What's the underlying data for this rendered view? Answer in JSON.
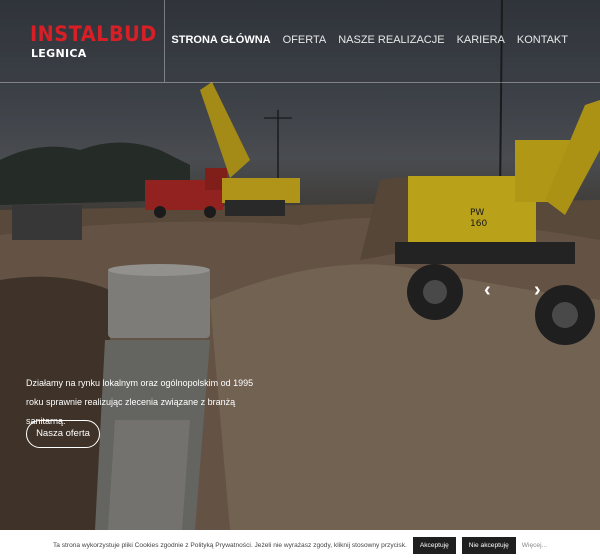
{
  "brand": {
    "name": "INSTALBUD",
    "city": "LEGNICA"
  },
  "nav": {
    "items": [
      {
        "label": "STRONA GŁÓWNA",
        "active": true
      },
      {
        "label": "OFERTA",
        "active": false
      },
      {
        "label": "NASZE REALIZACJE",
        "active": false
      },
      {
        "label": "KARIERA",
        "active": false
      },
      {
        "label": "KONTAKT",
        "active": false
      }
    ]
  },
  "hero": {
    "tagline": "Działamy na rynku lokalnym oraz ogólnopolskim od 1995 roku sprawnie realizując zlecenia związane z branżą sanitarną.",
    "cta_label": "Nasza oferta",
    "prev_arrow": "‹",
    "next_arrow": "›"
  },
  "cookie": {
    "text": "Ta strona wykorzystuje pliki Cookies zgodnie z Polityką Prywatności. Jeżeli nie wyrażasz zgody, kliknij stosowny przycisk.",
    "accept_label": "Akceptuję",
    "decline_label": "Nie akceptuję",
    "more_label": "Więcej..."
  },
  "colors": {
    "brand_red": "#d81f26",
    "excavator_yellow": "#e2c51f"
  }
}
